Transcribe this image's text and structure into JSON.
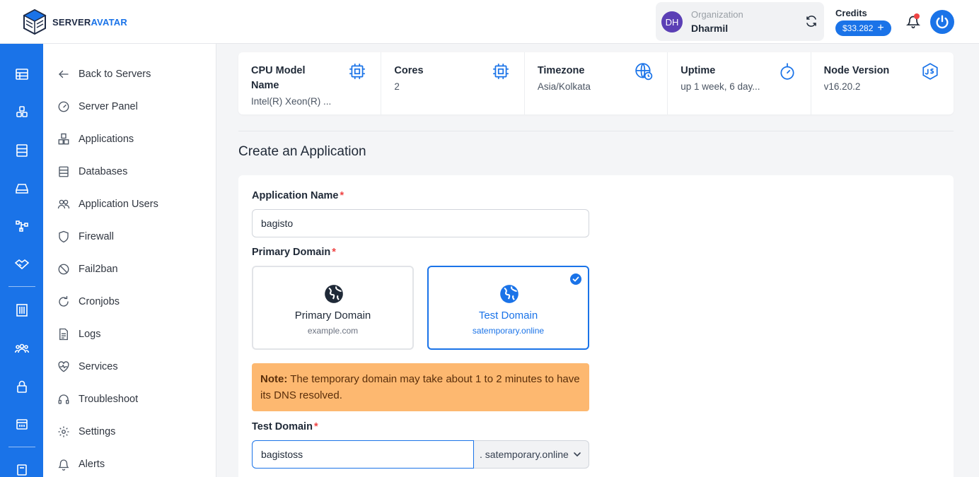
{
  "header": {
    "logo_text_a": "SERVER",
    "logo_text_b": "AVATAR",
    "org_initials": "DH",
    "org_label": "Organization",
    "org_name": "Dharmil",
    "credits_label": "Credits",
    "credits_value": "$33.282",
    "credits_add": "+"
  },
  "sidebar": {
    "items": [
      {
        "label": "Back to Servers",
        "icon": "arrow-left-icon"
      },
      {
        "label": "Server Panel",
        "icon": "gauge-icon"
      },
      {
        "label": "Applications",
        "icon": "cubes-icon"
      },
      {
        "label": "Databases",
        "icon": "database-icon"
      },
      {
        "label": "Application Users",
        "icon": "users-icon"
      },
      {
        "label": "Firewall",
        "icon": "shield-icon"
      },
      {
        "label": "Fail2ban",
        "icon": "ban-icon"
      },
      {
        "label": "Cronjobs",
        "icon": "refresh-icon"
      },
      {
        "label": "Logs",
        "icon": "file-icon"
      },
      {
        "label": "Services",
        "icon": "heartbeat-icon"
      },
      {
        "label": "Troubleshoot",
        "icon": "headset-icon"
      },
      {
        "label": "Settings",
        "icon": "gear-icon"
      },
      {
        "label": "Alerts",
        "icon": "bell-icon"
      }
    ]
  },
  "stats": [
    {
      "label": "CPU Model Name",
      "value": "Intel(R) Xeon(R) ...",
      "icon": "cpu-icon"
    },
    {
      "label": "Cores",
      "value": "2",
      "icon": "cpu-icon"
    },
    {
      "label": "Timezone",
      "value": "Asia/Kolkata",
      "icon": "globe-clock-icon"
    },
    {
      "label": "Uptime",
      "value": "up 1 week, 6 day...",
      "icon": "stopwatch-icon"
    },
    {
      "label": "Node Version",
      "value": "v16.20.2",
      "icon": "nodejs-icon"
    }
  ],
  "form": {
    "section_title": "Create an Application",
    "app_name_label": "Application Name",
    "app_name_value": "bagisto",
    "primary_domain_label": "Primary Domain",
    "required_mark": "*",
    "options": [
      {
        "title": "Primary Domain",
        "subtitle": "example.com",
        "selected": false
      },
      {
        "title": "Test Domain",
        "subtitle": "satemporary.online",
        "selected": true
      }
    ],
    "note_prefix": "Note:",
    "note_text": " The temporary domain may take about 1 to 2 minutes to have its DNS resolved.",
    "test_domain_label": "Test Domain",
    "test_domain_value": "bagistoss",
    "test_domain_suffix": ". satemporary.online"
  },
  "colors": {
    "brand_blue": "#1a73e8",
    "note_bg": "#fdb870",
    "required_red": "#ef4444"
  }
}
